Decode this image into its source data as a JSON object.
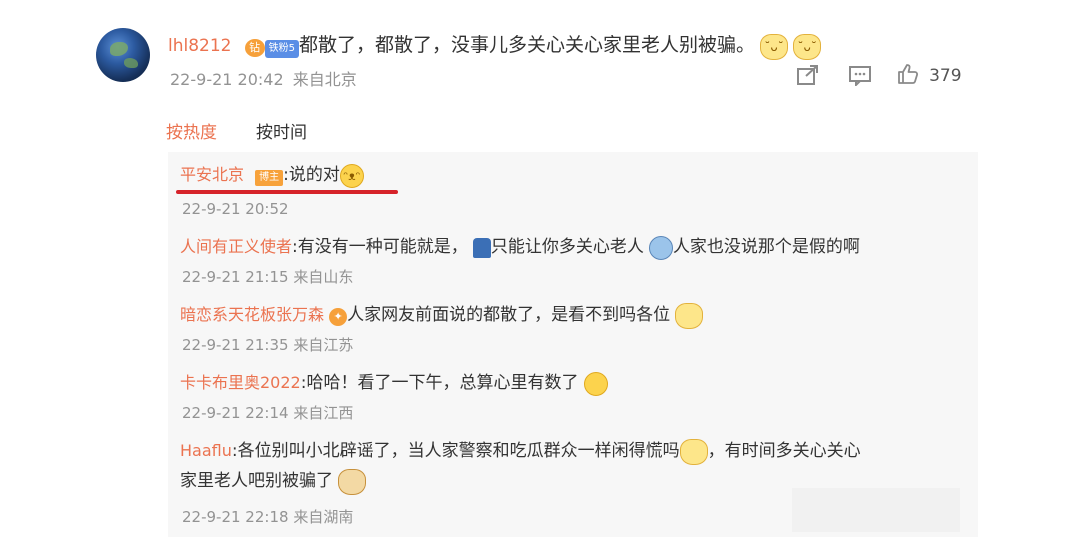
{
  "comment": {
    "username": "lhl8212",
    "vip_badge_text": "钻",
    "fan_badge_text": "铁粉5",
    "text": "都散了，都散了，没事儿多关心关心家里老人别被骗。",
    "emojis": [
      "˘ᴗ˘",
      "˘ᴗ˘"
    ],
    "date": "22-9-21 20:42",
    "location": "来自北京",
    "like_count": "379"
  },
  "tabs": {
    "hot": "按热度",
    "time": "按时间"
  },
  "replies": [
    {
      "name": "平安北京",
      "badge": "博主",
      "text": ":说的对",
      "emoji": "ᵔᴥᵔ",
      "date": "22-9-21 20:52",
      "location": ""
    },
    {
      "name": "人间有正义使者",
      "text": ":有没有一种可能就是，",
      "text2": "只能让你多关心老人",
      "text3": "人家也没说那个是假的啊",
      "date": "22-9-21 21:15",
      "location": "来自山东"
    },
    {
      "name": "暗恋系天花板张万森",
      "text": "人家网友前面说的都散了，是看不到吗各位",
      "date": "22-9-21 21:35",
      "location": "来自江苏"
    },
    {
      "name": "卡卡布里奥2022",
      "text": ":哈哈！看了一下午，总算心里有数了",
      "date": "22-9-21 22:14",
      "location": "来自江西"
    },
    {
      "name": "Haaflu",
      "text": ":各位别叫小北辟谣了，当人家警察和吃瓜群众一样闲得慌吗",
      "text2": "，有时间多关心关心",
      "text3": "家里老人吧别被骗了",
      "date": "22-9-21 22:18",
      "location": "来自湖南"
    }
  ]
}
